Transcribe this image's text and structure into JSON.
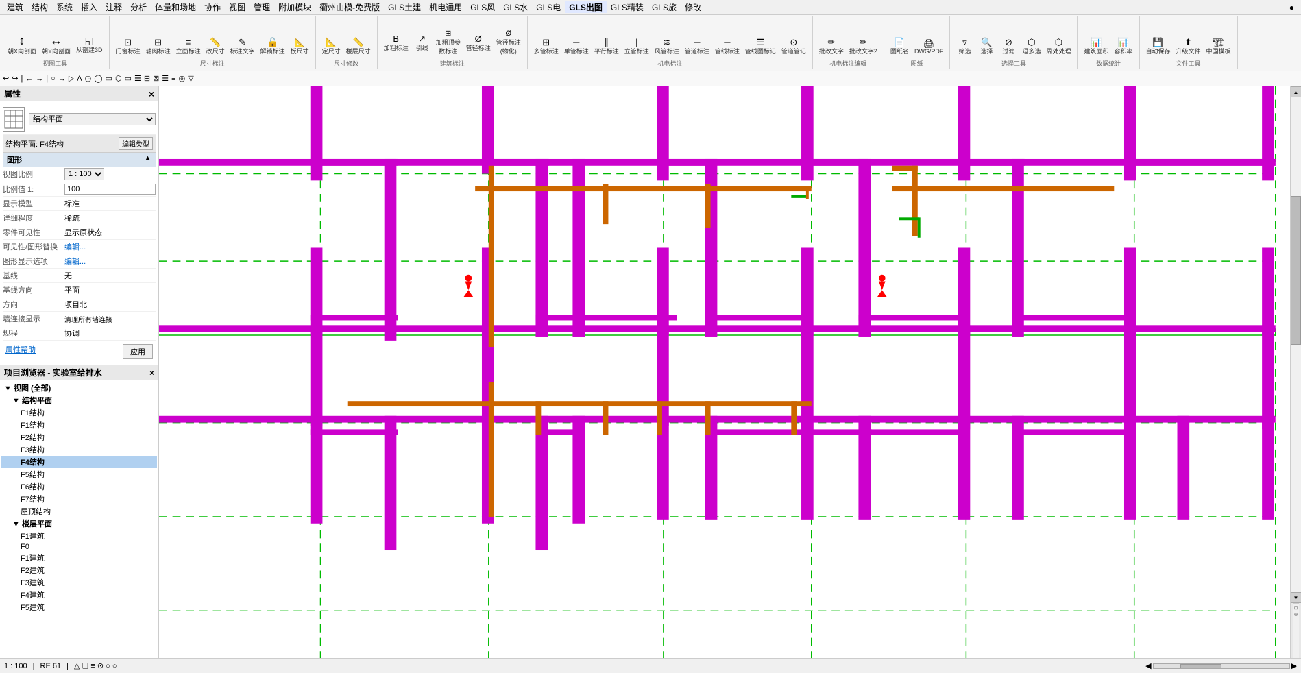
{
  "menubar": {
    "items": [
      "建筑",
      "结构",
      "系统",
      "插入",
      "注释",
      "分析",
      "体量和场地",
      "协作",
      "视图",
      "管理",
      "附加模块",
      "衢州山模-免费版",
      "GLS土建",
      "机电通用",
      "GLS风",
      "GLS水",
      "GLS电",
      "GLS出图",
      "GLS精装",
      "GLS旅",
      "修改",
      "●"
    ]
  },
  "ribbon": {
    "groups": [
      {
        "label": "视图工具",
        "buttons": [
          {
            "icon": "↕",
            "label": "朝X向剖面"
          },
          {
            "icon": "↔",
            "label": "朝Y向剖面"
          },
          {
            "icon": "◱",
            "label": "从剖建3D"
          }
        ]
      },
      {
        "label": "尺寸标注",
        "buttons": [
          {
            "icon": "⊡",
            "label": "门窗标注"
          },
          {
            "icon": "▭",
            "label": "轴网标注"
          },
          {
            "icon": "≡",
            "label": "立面标注"
          },
          {
            "icon": "📏",
            "label": "改尺寸"
          },
          {
            "icon": "📐",
            "label": "标注文字"
          },
          {
            "icon": "📏",
            "label": "解锁标注"
          },
          {
            "icon": "📏",
            "label": "板尺寸"
          }
        ]
      },
      {
        "label": "尺寸修改",
        "buttons": [
          {
            "icon": "📐",
            "label": "定尺寸"
          },
          {
            "icon": "📐",
            "label": "楼层尺寸"
          }
        ]
      },
      {
        "label": "建筑标注",
        "buttons": [
          {
            "icon": "📌",
            "label": "加粗标注"
          },
          {
            "icon": "🔗",
            "label": "引线"
          },
          {
            "icon": "▭",
            "label": "加粗顶参数标注"
          },
          {
            "icon": "📋",
            "label": "管径标注"
          },
          {
            "icon": "📋",
            "label": "管径标注(物化)"
          }
        ]
      },
      {
        "label": "机电标注",
        "buttons": [
          {
            "icon": "⊞",
            "label": "多管标注"
          },
          {
            "icon": "◎",
            "label": "单管标注"
          },
          {
            "icon": "≡",
            "label": "平行标注"
          },
          {
            "icon": "⊡",
            "label": "立管标注"
          },
          {
            "icon": "🌀",
            "label": "风管标注"
          },
          {
            "icon": "▭",
            "label": "管道标注"
          },
          {
            "icon": "▭",
            "label": "管线标注"
          },
          {
            "icon": "▭",
            "label": "管线图标记"
          },
          {
            "icon": "▭",
            "label": "管道管记"
          }
        ]
      },
      {
        "label": "机电标注编辑",
        "buttons": [
          {
            "icon": "✏",
            "label": "批改文字"
          },
          {
            "icon": "✏",
            "label": "批改文字2"
          }
        ]
      },
      {
        "label": "图纸",
        "buttons": [
          {
            "icon": "📄",
            "label": "图纸名"
          },
          {
            "icon": "🖨",
            "label": "DWG/PDF"
          }
        ]
      },
      {
        "label": "选择工具",
        "buttons": [
          {
            "icon": "▷",
            "label": "筛选"
          },
          {
            "icon": "🔍",
            "label": "选择"
          },
          {
            "icon": "✕",
            "label": "过滤"
          },
          {
            "icon": "⬡",
            "label": "逗多选"
          },
          {
            "icon": "⬡",
            "label": "周处处理"
          }
        ]
      },
      {
        "label": "数据统计",
        "buttons": [
          {
            "icon": "📊",
            "label": "建筑面积"
          },
          {
            "icon": "📊",
            "label": "容积率"
          }
        ]
      },
      {
        "label": "文件工具",
        "buttons": [
          {
            "icon": "💾",
            "label": "自动保存"
          },
          {
            "icon": "📄",
            "label": "升级文件"
          },
          {
            "icon": "🏗",
            "label": "中国模板"
          }
        ]
      }
    ]
  },
  "cmdbar": {
    "tools": [
      "↩",
      "↪",
      "→",
      "↩",
      "↪",
      "○",
      "→",
      "▷",
      "A",
      "◷",
      "◯",
      "▭",
      "⬡",
      "▭",
      "☰",
      "⊞",
      "⊠",
      "☰",
      "≡",
      "◎",
      "▽"
    ]
  },
  "properties": {
    "title": "属性",
    "view_type": "结构平面",
    "floor_plan_label": "结构平面: F4结构",
    "edit_type_label": "编辑类型",
    "section_graphics": "图形",
    "view_scale_label": "视图比例",
    "view_scale_value": "1 : 100",
    "scale_label": "比例值 1:",
    "scale_value": "100",
    "display_model_label": "显示模型",
    "display_model_value": "标准",
    "detail_level_label": "详细程度",
    "detail_level_value": "稀疏",
    "parts_label": "零件可见性",
    "parts_value": "显示原状态",
    "vis_replace_label": "可见性/图形替换",
    "vis_replace_value": "编辑...",
    "graphic_opts_label": "图形显示选项",
    "graphic_opts_value": "编辑...",
    "baseline_label": "基线",
    "baseline_value": "无",
    "baseline_dir_label": "基线方向",
    "baseline_dir_value": "平面",
    "direction_label": "方向",
    "direction_value": "项目北",
    "wall_connect_label": "墙连接显示",
    "wall_connect_value": "清理所有墙连接",
    "discipline_label": "规程",
    "discipline_value": "协调",
    "prop_help_label": "属性帮助",
    "apply_label": "应用"
  },
  "project_browser": {
    "title": "项目浏览器 - 实验室给排水",
    "close_label": "×",
    "items": [
      {
        "level": 0,
        "type": "expand",
        "label": "视图 (全部)",
        "expanded": true
      },
      {
        "level": 1,
        "type": "expand",
        "label": "结构平面",
        "expanded": true
      },
      {
        "level": 2,
        "type": "item",
        "label": "F1结构"
      },
      {
        "level": 2,
        "type": "item",
        "label": "F1结构"
      },
      {
        "level": 2,
        "type": "item",
        "label": "F2结构"
      },
      {
        "level": 2,
        "type": "item",
        "label": "F3结构"
      },
      {
        "level": 2,
        "type": "selected",
        "label": "F4结构"
      },
      {
        "level": 2,
        "type": "item",
        "label": "F5结构"
      },
      {
        "level": 2,
        "type": "item",
        "label": "F6结构"
      },
      {
        "level": 2,
        "type": "item",
        "label": "F7结构"
      },
      {
        "level": 2,
        "type": "item",
        "label": "屋顶结构"
      },
      {
        "level": 1,
        "type": "expand",
        "label": "楼层平面",
        "expanded": true
      },
      {
        "level": 2,
        "type": "item",
        "label": "F1建筑"
      },
      {
        "level": 2,
        "type": "item",
        "label": "F0"
      },
      {
        "level": 2,
        "type": "item",
        "label": "F1建筑"
      },
      {
        "level": 2,
        "type": "item",
        "label": "F2建筑"
      },
      {
        "level": 2,
        "type": "item",
        "label": "F3建筑"
      },
      {
        "level": 2,
        "type": "item",
        "label": "F4建筑"
      },
      {
        "level": 2,
        "type": "item",
        "label": "F5建筑"
      }
    ]
  },
  "statusbar": {
    "scale": "1 : 100",
    "zoom": "RE 61",
    "extra": "△ ❏ ≡ ☯ ○ ○"
  },
  "canvas": {
    "bg_color": "#ffffff",
    "accent": "#cc00cc",
    "orange": "#cc6600",
    "green": "#00cc00",
    "red": "#cc0000"
  }
}
